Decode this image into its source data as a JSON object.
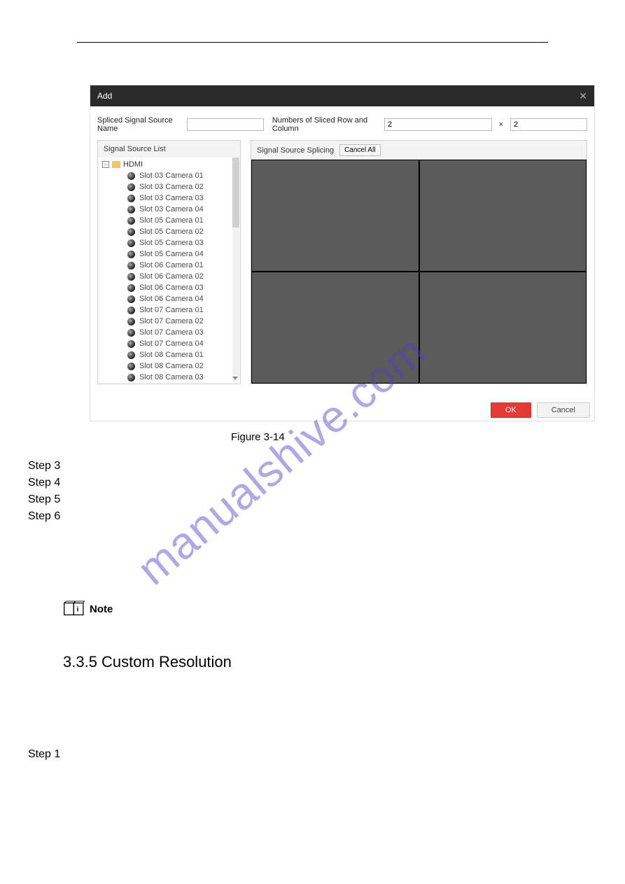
{
  "watermark": "manualshive.com",
  "dialog": {
    "title": "Add",
    "splicedNameLabel": "Spliced Signal Source Name",
    "splicedNameValue": "",
    "rowColLabel": "Numbers of Sliced Row and Column",
    "rowValue": "2",
    "colValue": "2",
    "multiply": "×",
    "sourceListHeader": "Signal Source List",
    "splicingHeader": "Signal Source Splicing",
    "cancelAllLabel": "Cancel All",
    "rootLabel": "HDMI",
    "cameras": [
      "Slot 03 Camera 01",
      "Slot 03 Camera 02",
      "Slot 03 Camera 03",
      "Slot 03 Camera 04",
      "Slot 05 Camera 01",
      "Slot 05 Camera 02",
      "Slot 05 Camera 03",
      "Slot 05 Camera 04",
      "Slot 06 Camera 01",
      "Slot 06 Camera 02",
      "Slot 06 Camera 03",
      "Slot 06 Camera 04",
      "Slot 07 Camera 01",
      "Slot 07 Camera 02",
      "Slot 07 Camera 03",
      "Slot 07 Camera 04",
      "Slot 08 Camera 01",
      "Slot 08 Camera 02",
      "Slot 08 Camera 03"
    ],
    "okLabel": "OK",
    "cancelLabel": "Cancel"
  },
  "figure": {
    "caption": "Figure 3-14"
  },
  "steps": {
    "s3": "Step 3",
    "s4": "Step 4",
    "s5": "Step 5",
    "s6": "Step 6"
  },
  "noteLabel": "Note",
  "sectionHeading": "3.3.5 Custom Resolution",
  "bottomStep": "Step 1"
}
